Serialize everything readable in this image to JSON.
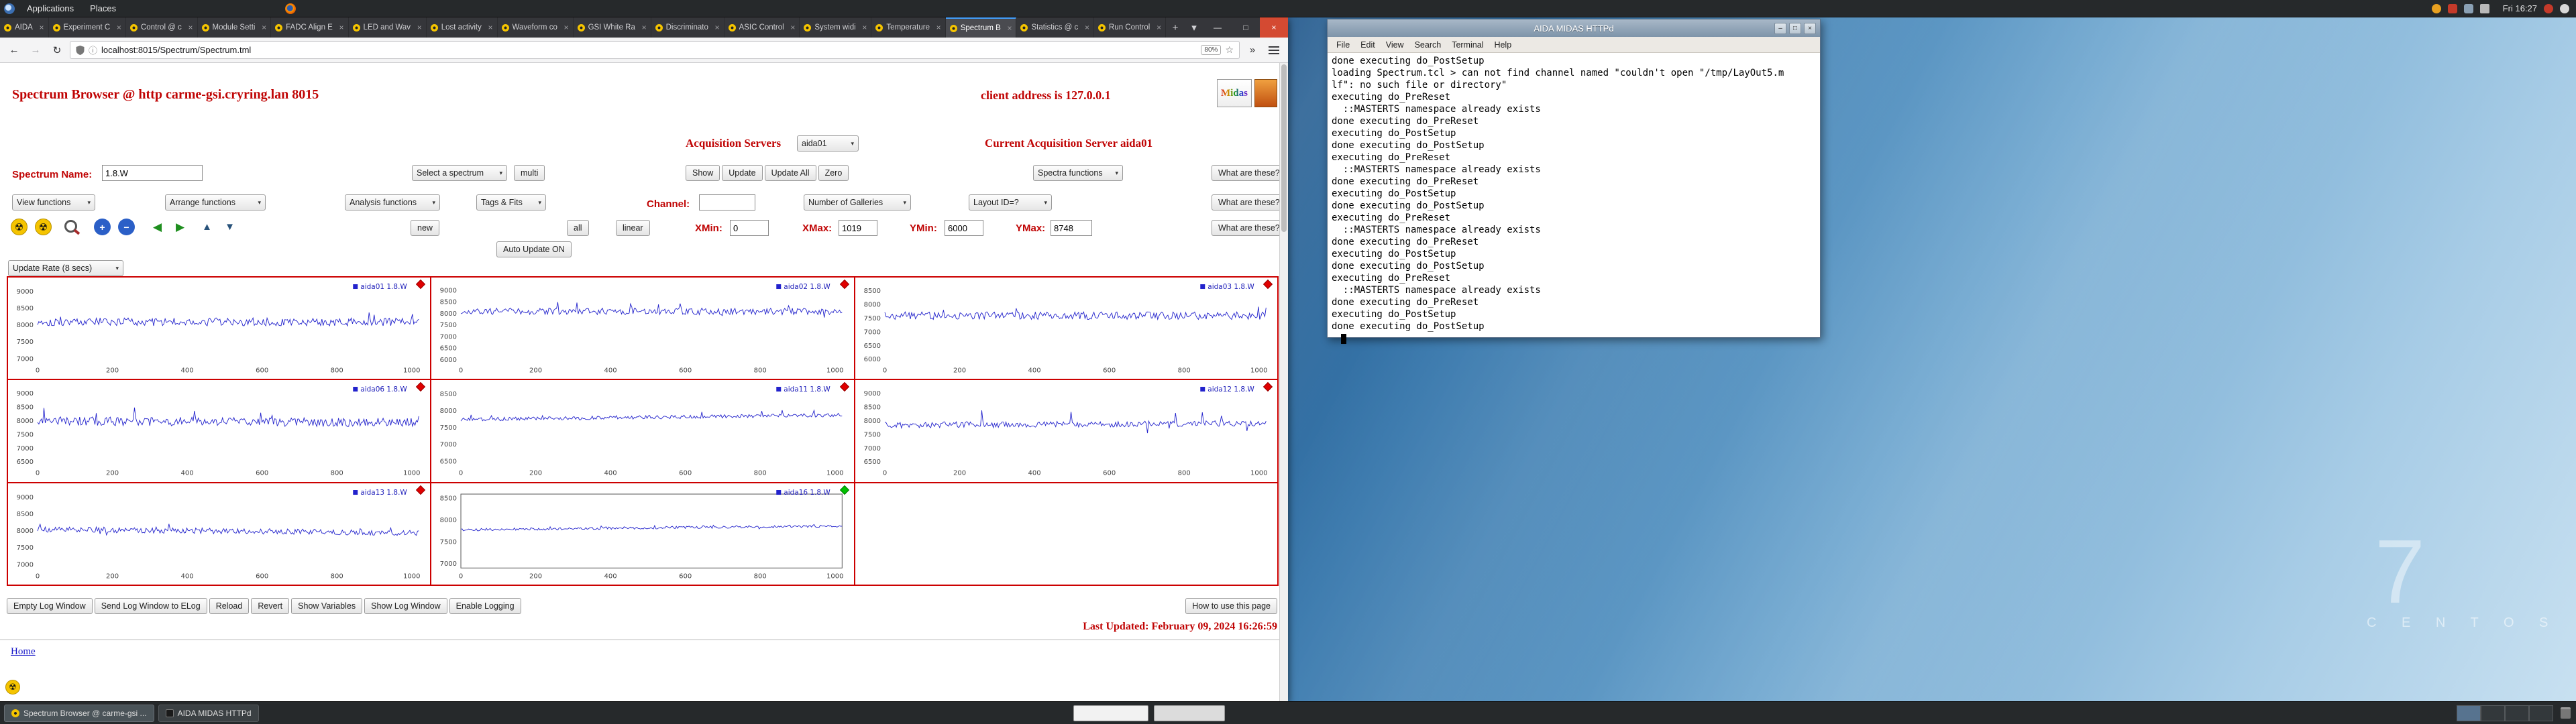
{
  "top_panel": {
    "applications": "Applications",
    "places": "Places",
    "clock": "Fri 16:27"
  },
  "browser": {
    "active_tab_index": 13,
    "tabs": [
      {
        "label": "AIDA"
      },
      {
        "label": "Experiment C"
      },
      {
        "label": "Control @ c"
      },
      {
        "label": "Module Setti"
      },
      {
        "label": "FADC Align E"
      },
      {
        "label": "LED and Wav"
      },
      {
        "label": "Lost activity"
      },
      {
        "label": "Waveform co"
      },
      {
        "label": "GSI White Ra"
      },
      {
        "label": "Discriminato"
      },
      {
        "label": "ASIC Control"
      },
      {
        "label": "System widi"
      },
      {
        "label": "Temperature"
      },
      {
        "label": "Spectrum B"
      },
      {
        "label": "Statistics @ c"
      },
      {
        "label": "Run Control"
      }
    ],
    "url": "localhost:8015/Spectrum/Spectrum.tml",
    "zoom": "80%"
  },
  "page": {
    "title": "Spectrum Browser @ http carme-gsi.cryring.lan 8015",
    "client_address": "client address is 127.0.0.1",
    "logo_text": "Midas"
  },
  "controls": {
    "acq_servers_label": "Acquisition Servers",
    "acq_server_value": "aida01",
    "current_server": "Current Acquisition Server aida01",
    "spectrum_name_label": "Spectrum Name:",
    "spectrum_name_value": "1.8.W",
    "select_spectrum": "Select a spectrum",
    "multi": "multi",
    "show": "Show",
    "update": "Update",
    "update_all": "Update All",
    "zero": "Zero",
    "spectra_functions": "Spectra functions",
    "what_are_these": "What are these?",
    "view_functions": "View functions",
    "arrange_functions": "Arrange functions",
    "analysis_functions": "Analysis functions",
    "tags_fits": "Tags & Fits",
    "channel_label": "Channel:",
    "channel_value": "",
    "number_of_galleries": "Number of Galleries",
    "layout_id": "Layout ID=?",
    "new": "new",
    "all": "all",
    "linear": "linear",
    "xmin_label": "XMin:",
    "xmin_value": "0",
    "xmax_label": "XMax:",
    "xmax_value": "1019",
    "ymin_label": "YMin:",
    "ymin_value": "6000",
    "ymax_label": "YMax:",
    "ymax_value": "8748",
    "auto_update": "Auto Update ON",
    "update_rate": "Update Rate (8 secs)"
  },
  "spectra": {
    "xticks": [
      0,
      200,
      400,
      600,
      800,
      1000
    ],
    "charts": [
      {
        "legend": "aida01 1.8.W",
        "marker": "red",
        "ymin": 6900,
        "ymax": 9100,
        "yticks": [
          9000,
          8500,
          8000,
          7500,
          7000
        ],
        "baseline": 8100,
        "noise": 120,
        "spike": 500,
        "drift": 0,
        "seed": 101,
        "empty": false
      },
      {
        "legend": "aida02 1.8.W",
        "marker": "red",
        "ymin": 5900,
        "ymax": 9100,
        "yticks": [
          9000,
          8500,
          8000,
          7500,
          7000,
          6500,
          6000
        ],
        "baseline": 8100,
        "noise": 140,
        "spike": 700,
        "drift": 0,
        "seed": 202,
        "empty": false
      },
      {
        "legend": "aida03 1.8.W",
        "marker": "red",
        "ymin": 5900,
        "ymax": 8600,
        "yticks": [
          8500,
          8000,
          7500,
          7000,
          6500,
          6000
        ],
        "baseline": 7600,
        "noise": 140,
        "spike": 600,
        "drift": 0,
        "seed": 303,
        "empty": false
      },
      {
        "legend": "aida06 1.8.W",
        "marker": "red",
        "ymin": 6400,
        "ymax": 9100,
        "yticks": [
          9000,
          8500,
          8000,
          7500,
          7000,
          6500
        ],
        "baseline": 8000,
        "noise": 160,
        "spike": 700,
        "drift": -60,
        "seed": 404,
        "empty": false
      },
      {
        "legend": "aida11 1.8.W",
        "marker": "red",
        "ymin": 6400,
        "ymax": 8600,
        "yticks": [
          8500,
          8000,
          7500,
          7000,
          6500
        ],
        "baseline": 7750,
        "noise": 55,
        "spike": 220,
        "drift": 130,
        "seed": 505,
        "empty": false
      },
      {
        "legend": "aida12 1.8.W",
        "marker": "red",
        "ymin": 6400,
        "ymax": 9100,
        "yticks": [
          9000,
          8500,
          8000,
          7500,
          7000,
          6500
        ],
        "baseline": 7850,
        "noise": 110,
        "spike": 800,
        "drift": 60,
        "seed": 606,
        "empty": false
      },
      {
        "legend": "aida13 1.8.W",
        "marker": "red",
        "ymin": 6900,
        "ymax": 9100,
        "yticks": [
          9000,
          8500,
          8000,
          7500,
          7000
        ],
        "baseline": 8050,
        "noise": 85,
        "spike": 320,
        "drift": -100,
        "seed": 707,
        "empty": false
      },
      {
        "legend": "aida16 1.8.W",
        "marker": "green",
        "ymin": 6900,
        "ymax": 8600,
        "yticks": [
          8500,
          8000,
          7500,
          7000
        ],
        "baseline": 7780,
        "noise": 30,
        "spike": 110,
        "drift": 90,
        "seed": 808,
        "boxed": true,
        "empty": false
      },
      {
        "empty": true
      }
    ]
  },
  "footer": {
    "buttons": [
      "Empty Log Window",
      "Send Log Window to ELog",
      "Reload",
      "Revert",
      "Show Variables",
      "Show Log Window",
      "Enable Logging"
    ],
    "help_button": "How to use this page",
    "last_updated": "Last Updated: February 09, 2024 16:26:59",
    "home": "Home"
  },
  "terminal": {
    "title": "AIDA MIDAS HTTPd",
    "menus": [
      "File",
      "Edit",
      "View",
      "Search",
      "Terminal",
      "Help"
    ],
    "lines": [
      "done executing do_PostSetup",
      "loading Spectrum.tcl > can not find channel named \"couldn't open \"/tmp/LayOut5.m",
      "lf\": no such file or directory\"",
      "executing do_PreReset",
      "  ::MASTERTS namespace already exists",
      "done executing do_PreReset",
      "executing do_PostSetup",
      "done executing do_PostSetup",
      "executing do_PreReset",
      "  ::MASTERTS namespace already exists",
      "done executing do_PreReset",
      "executing do_PostSetup",
      "done executing do_PostSetup",
      "executing do_PreReset",
      "  ::MASTERTS namespace already exists",
      "done executing do_PreReset",
      "executing do_PostSetup",
      "done executing do_PostSetup",
      "executing do_PreReset",
      "  ::MASTERTS namespace already exists",
      "done executing do_PreReset",
      "executing do_PostSetup",
      "done executing do_PostSetup"
    ]
  },
  "taskbar": {
    "windows": [
      {
        "title": "Spectrum Browser @ carme-gsi ..."
      },
      {
        "title": "AIDA MIDAS HTTPd"
      }
    ]
  },
  "wallpaper": {
    "seven": "7",
    "brand": "C E N T O S"
  }
}
